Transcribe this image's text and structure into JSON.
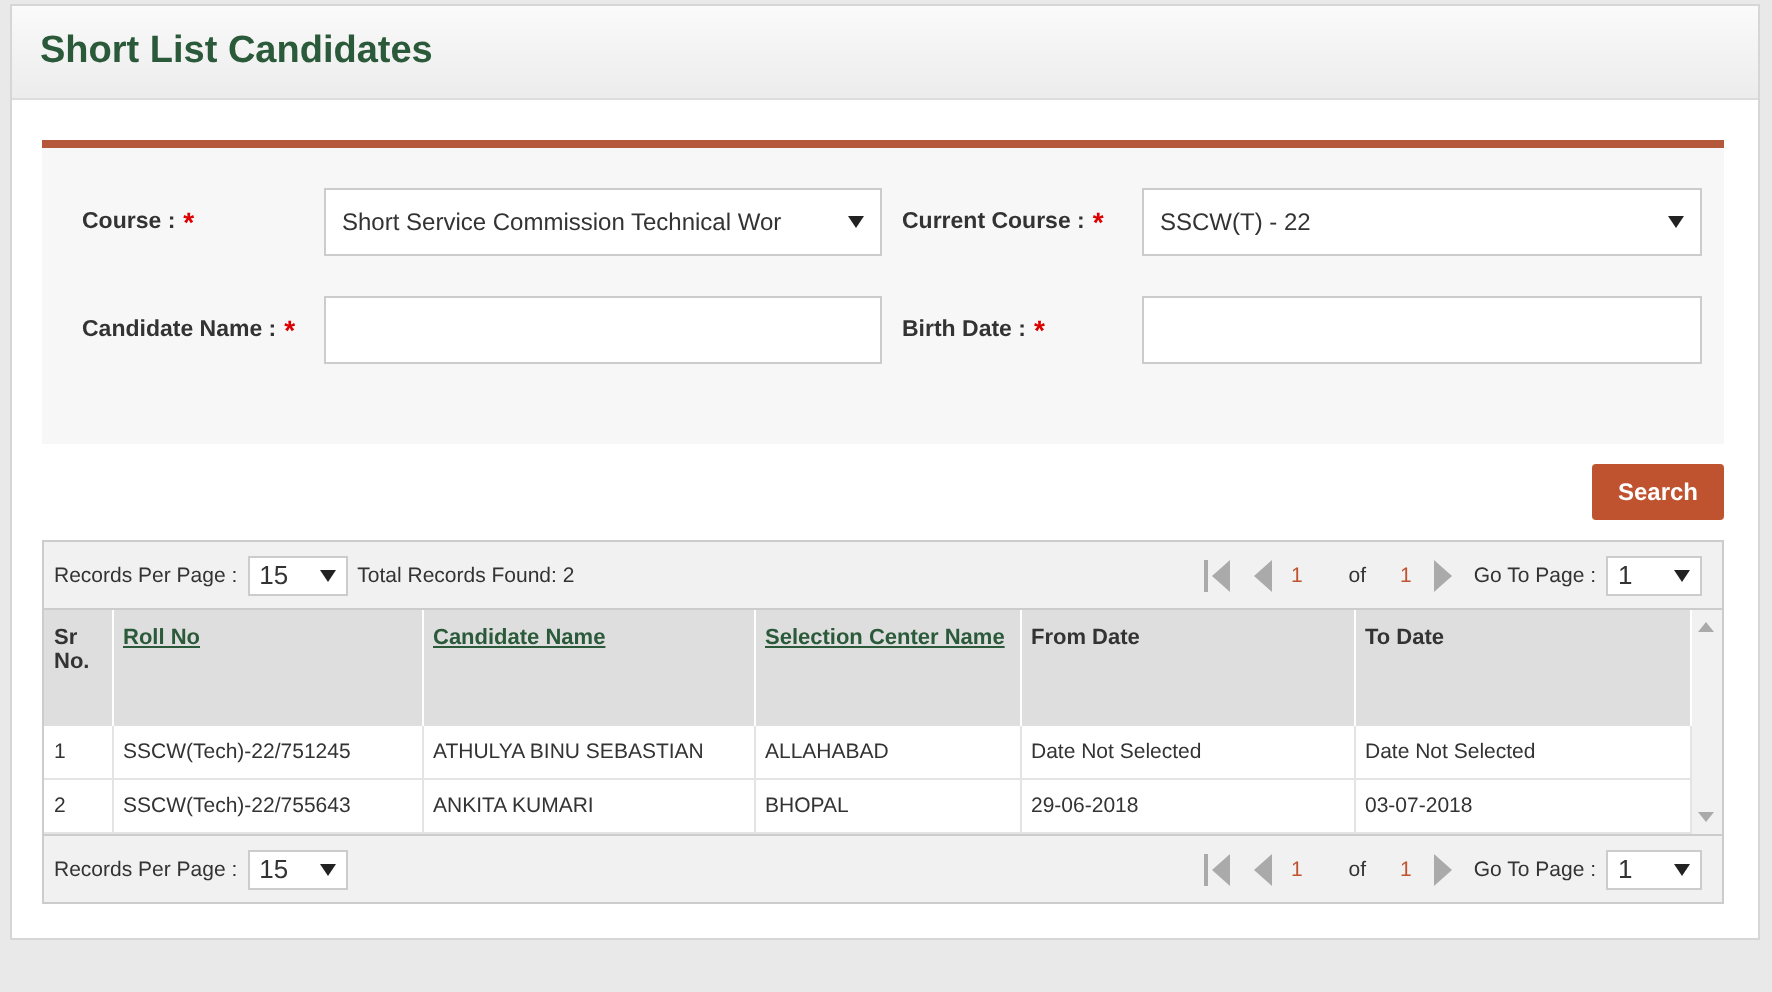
{
  "title": "Short List Candidates",
  "form": {
    "fields": [
      {
        "label": "Course :",
        "required": true,
        "mark": "*",
        "kind": "select",
        "value": "Short Service Commission Technical Wor"
      },
      {
        "label": "Current Course :",
        "required": true,
        "mark": "*",
        "kind": "select",
        "value": "SSCW(T) - 22"
      },
      {
        "label": "Candidate Name :",
        "required": true,
        "mark": "*",
        "kind": "input"
      },
      {
        "label": "Birth Date :",
        "required": true,
        "mark": "*",
        "kind": "input"
      }
    ]
  },
  "search_button": "Search",
  "grid": {
    "top_bar": {
      "records_label": "Records Per Page :",
      "per_page": "15",
      "total": "Total Records Found: 2",
      "page": "1",
      "of": "of",
      "total_pages": "1",
      "goto_label": "Go To Page :",
      "goto_value": "1"
    },
    "columns": [
      {
        "label": "Sr No.",
        "sortable": false
      },
      {
        "label": "Roll No",
        "sortable": true
      },
      {
        "label": "Candidate Name",
        "sortable": true
      },
      {
        "label": "Selection Center Name",
        "sortable": true
      },
      {
        "label": "From Date",
        "sortable": false
      },
      {
        "label": "To Date",
        "sortable": false
      }
    ],
    "rows": [
      [
        "1",
        "SSCW(Tech)-22/751245",
        "ATHULYA BINU SEBASTIAN",
        "ALLAHABAD",
        "Date Not Selected",
        "Date Not Selected"
      ],
      [
        "2",
        "SSCW(Tech)-22/755643",
        "ANKITA KUMARI",
        "BHOPAL",
        "29-06-2018",
        "03-07-2018"
      ]
    ],
    "bottom_bar": {
      "records_label": "Records Per Page :",
      "per_page": "15",
      "page": "1",
      "of": "of",
      "total_pages": "1",
      "goto_label": "Go To Page :",
      "goto_value": "1"
    }
  }
}
